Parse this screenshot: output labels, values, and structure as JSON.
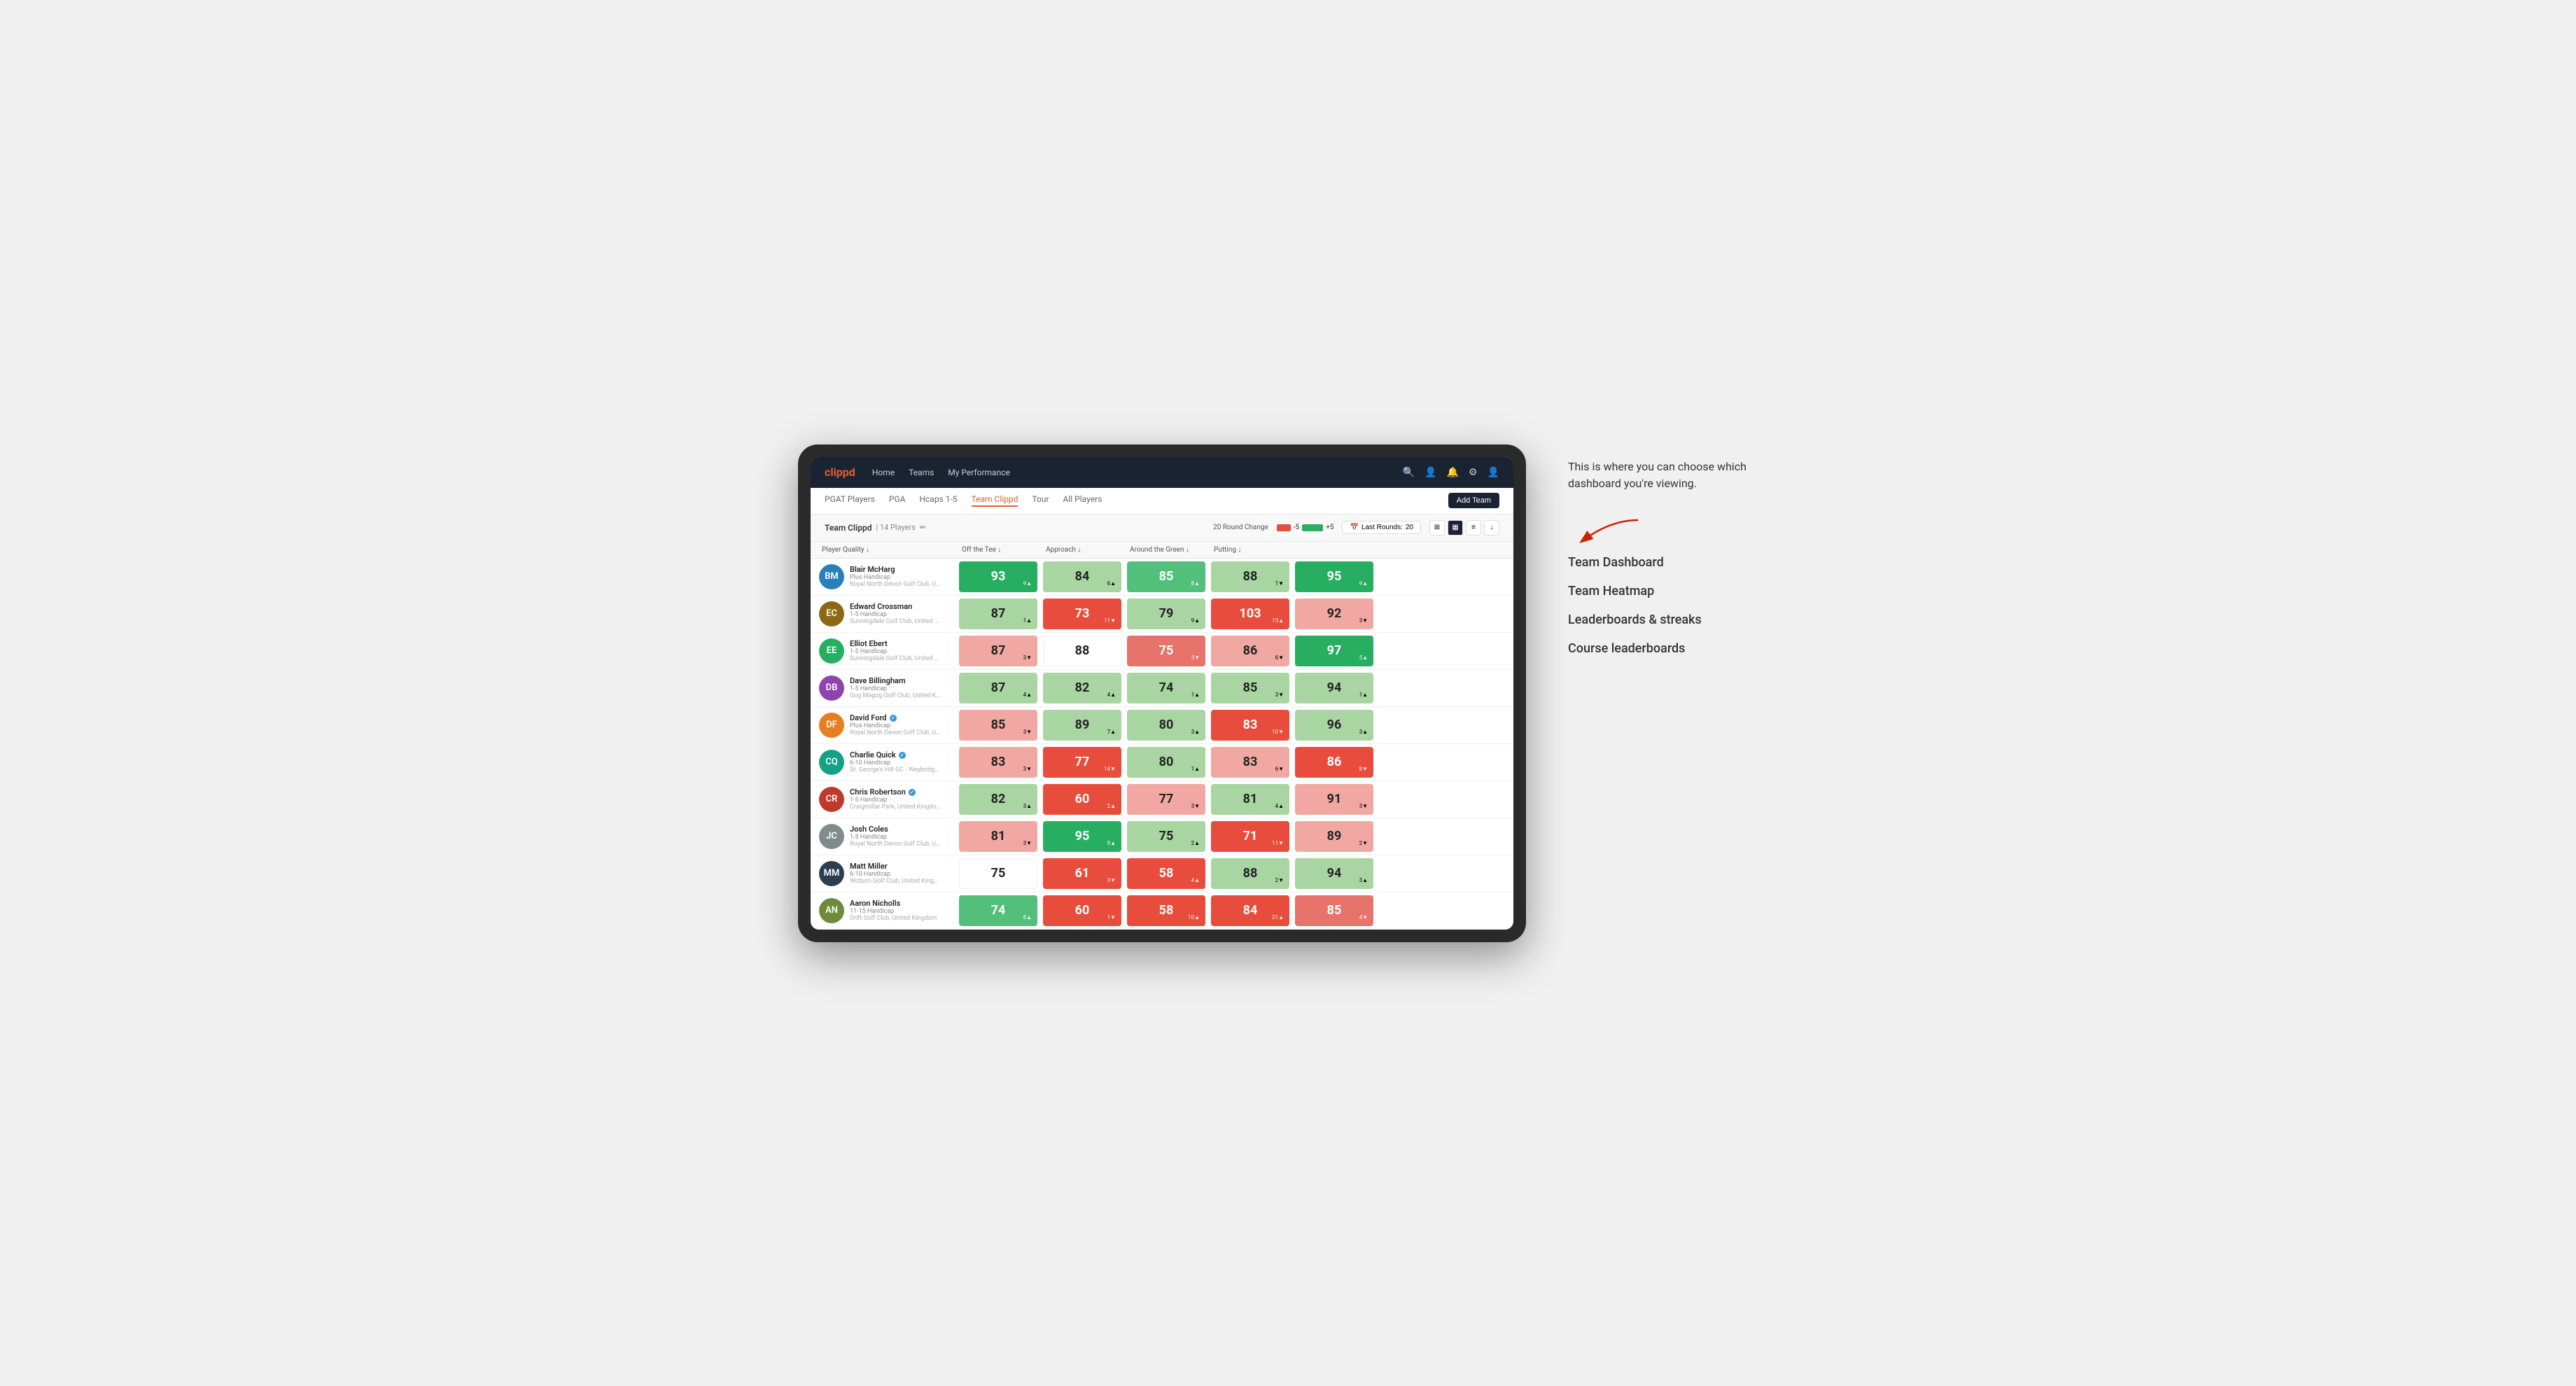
{
  "annotation": {
    "description": "This is where you can choose which dashboard you're viewing.",
    "arrow_label": "→",
    "items": [
      "Team Dashboard",
      "Team Heatmap",
      "Leaderboards & streaks",
      "Course leaderboards"
    ]
  },
  "nav": {
    "logo": "clippd",
    "links": [
      "Home",
      "Teams",
      "My Performance"
    ],
    "icons": [
      "🔍",
      "👤",
      "🔔",
      "⚙",
      "👤"
    ]
  },
  "sub_nav": {
    "links": [
      "PGAT Players",
      "PGA",
      "Hcaps 1-5",
      "Team Clippd",
      "Tour",
      "All Players"
    ],
    "active": "Team Clippd",
    "add_button": "Add Team"
  },
  "team_header": {
    "name": "Team Clippd",
    "separator": "|",
    "count": "14 Players",
    "round_change_label": "20 Round Change",
    "bar_neg": "-5",
    "bar_pos": "+5",
    "last_rounds_label": "Last Rounds:",
    "last_rounds_value": "20"
  },
  "table": {
    "columns": [
      "Player Quality ↓",
      "Off the Tee ↓",
      "Approach ↓",
      "Around the Green ↓",
      "Putting ↓"
    ],
    "players": [
      {
        "name": "Blair McHarg",
        "handicap": "Plus Handicap",
        "club": "Royal North Devon Golf Club, United Kingdom",
        "verified": false,
        "avatar_color": "av-blue",
        "initials": "BM",
        "stats": [
          {
            "value": "93",
            "change": "9▲",
            "dir": "up",
            "color": "green-dark"
          },
          {
            "value": "84",
            "change": "6▲",
            "dir": "up",
            "color": "green-light"
          },
          {
            "value": "85",
            "change": "8▲",
            "dir": "up",
            "color": "green-med"
          },
          {
            "value": "88",
            "change": "1▼",
            "dir": "down",
            "color": "green-light"
          },
          {
            "value": "95",
            "change": "9▲",
            "dir": "up",
            "color": "green-dark"
          }
        ]
      },
      {
        "name": "Edward Crossman",
        "handicap": "1-5 Handicap",
        "club": "Sunningdale Golf Club, United Kingdom",
        "verified": false,
        "avatar_color": "av-brown",
        "initials": "EC",
        "stats": [
          {
            "value": "87",
            "change": "1▲",
            "dir": "up",
            "color": "green-light"
          },
          {
            "value": "73",
            "change": "11▼",
            "dir": "down",
            "color": "red-dark"
          },
          {
            "value": "79",
            "change": "9▲",
            "dir": "up",
            "color": "green-light"
          },
          {
            "value": "103",
            "change": "15▲",
            "dir": "up",
            "color": "red-dark"
          },
          {
            "value": "92",
            "change": "3▼",
            "dir": "down",
            "color": "red-light"
          }
        ]
      },
      {
        "name": "Elliot Ebert",
        "handicap": "1-5 Handicap",
        "club": "Sunningdale Golf Club, United Kingdom",
        "verified": false,
        "avatar_color": "av-green",
        "initials": "EE",
        "stats": [
          {
            "value": "87",
            "change": "3▼",
            "dir": "down",
            "color": "red-light"
          },
          {
            "value": "88",
            "change": "",
            "dir": "",
            "color": "white-cell"
          },
          {
            "value": "75",
            "change": "3▼",
            "dir": "down",
            "color": "red-med"
          },
          {
            "value": "86",
            "change": "6▼",
            "dir": "down",
            "color": "red-light"
          },
          {
            "value": "97",
            "change": "5▲",
            "dir": "up",
            "color": "green-dark"
          }
        ]
      },
      {
        "name": "Dave Billingham",
        "handicap": "1-5 Handicap",
        "club": "Gog Magog Golf Club, United Kingdom",
        "verified": false,
        "avatar_color": "av-purple",
        "initials": "DB",
        "stats": [
          {
            "value": "87",
            "change": "4▲",
            "dir": "up",
            "color": "green-light"
          },
          {
            "value": "82",
            "change": "4▲",
            "dir": "up",
            "color": "green-light"
          },
          {
            "value": "74",
            "change": "1▲",
            "dir": "up",
            "color": "green-light"
          },
          {
            "value": "85",
            "change": "3▼",
            "dir": "down",
            "color": "green-light"
          },
          {
            "value": "94",
            "change": "1▲",
            "dir": "up",
            "color": "green-light"
          }
        ]
      },
      {
        "name": "David Ford",
        "handicap": "Plus Handicap",
        "club": "Royal North Devon Golf Club, United Kingdom",
        "verified": true,
        "avatar_color": "av-orange",
        "initials": "DF",
        "stats": [
          {
            "value": "85",
            "change": "3▼",
            "dir": "down",
            "color": "red-light"
          },
          {
            "value": "89",
            "change": "7▲",
            "dir": "up",
            "color": "green-light"
          },
          {
            "value": "80",
            "change": "3▲",
            "dir": "up",
            "color": "green-light"
          },
          {
            "value": "83",
            "change": "10▼",
            "dir": "down",
            "color": "red-dark"
          },
          {
            "value": "96",
            "change": "3▲",
            "dir": "up",
            "color": "green-light"
          }
        ]
      },
      {
        "name": "Charlie Quick",
        "handicap": "6-10 Handicap",
        "club": "St. George's Hill GC - Weybridge - Surrey, Uni...",
        "verified": true,
        "avatar_color": "av-teal",
        "initials": "CQ",
        "stats": [
          {
            "value": "83",
            "change": "3▼",
            "dir": "down",
            "color": "red-light"
          },
          {
            "value": "77",
            "change": "14▼",
            "dir": "down",
            "color": "red-dark"
          },
          {
            "value": "80",
            "change": "1▲",
            "dir": "up",
            "color": "green-light"
          },
          {
            "value": "83",
            "change": "6▼",
            "dir": "down",
            "color": "red-light"
          },
          {
            "value": "86",
            "change": "8▼",
            "dir": "down",
            "color": "red-dark"
          }
        ]
      },
      {
        "name": "Chris Robertson",
        "handicap": "1-5 Handicap",
        "club": "Craigmillar Park, United Kingdom",
        "verified": true,
        "avatar_color": "av-red",
        "initials": "CR",
        "stats": [
          {
            "value": "82",
            "change": "3▲",
            "dir": "up",
            "color": "green-light"
          },
          {
            "value": "60",
            "change": "2▲",
            "dir": "up",
            "color": "red-dark"
          },
          {
            "value": "77",
            "change": "3▼",
            "dir": "down",
            "color": "red-light"
          },
          {
            "value": "81",
            "change": "4▲",
            "dir": "up",
            "color": "green-light"
          },
          {
            "value": "91",
            "change": "3▼",
            "dir": "down",
            "color": "red-light"
          }
        ]
      },
      {
        "name": "Josh Coles",
        "handicap": "1-5 Handicap",
        "club": "Royal North Devon Golf Club, United Kingdom",
        "verified": false,
        "avatar_color": "av-gray",
        "initials": "JC",
        "stats": [
          {
            "value": "81",
            "change": "3▼",
            "dir": "down",
            "color": "red-light"
          },
          {
            "value": "95",
            "change": "8▲",
            "dir": "up",
            "color": "green-dark"
          },
          {
            "value": "75",
            "change": "2▲",
            "dir": "up",
            "color": "green-light"
          },
          {
            "value": "71",
            "change": "11▼",
            "dir": "down",
            "color": "red-dark"
          },
          {
            "value": "89",
            "change": "2▼",
            "dir": "down",
            "color": "red-light"
          }
        ]
      },
      {
        "name": "Matt Miller",
        "handicap": "6-10 Handicap",
        "club": "Woburn Golf Club, United Kingdom",
        "verified": false,
        "avatar_color": "av-dark",
        "initials": "MM",
        "stats": [
          {
            "value": "75",
            "change": "",
            "dir": "",
            "color": "white-cell"
          },
          {
            "value": "61",
            "change": "3▼",
            "dir": "down",
            "color": "red-dark"
          },
          {
            "value": "58",
            "change": "4▲",
            "dir": "up",
            "color": "red-dark"
          },
          {
            "value": "88",
            "change": "2▼",
            "dir": "down",
            "color": "green-light"
          },
          {
            "value": "94",
            "change": "3▲",
            "dir": "up",
            "color": "green-light"
          }
        ]
      },
      {
        "name": "Aaron Nicholls",
        "handicap": "11-15 Handicap",
        "club": "Drift Golf Club, United Kingdom",
        "verified": false,
        "avatar_color": "av-olive",
        "initials": "AN",
        "stats": [
          {
            "value": "74",
            "change": "8▲",
            "dir": "up",
            "color": "green-med"
          },
          {
            "value": "60",
            "change": "1▼",
            "dir": "down",
            "color": "red-dark"
          },
          {
            "value": "58",
            "change": "10▲",
            "dir": "up",
            "color": "red-dark"
          },
          {
            "value": "84",
            "change": "21▲",
            "dir": "up",
            "color": "red-dark"
          },
          {
            "value": "85",
            "change": "4▼",
            "dir": "down",
            "color": "red-med"
          }
        ]
      }
    ]
  }
}
